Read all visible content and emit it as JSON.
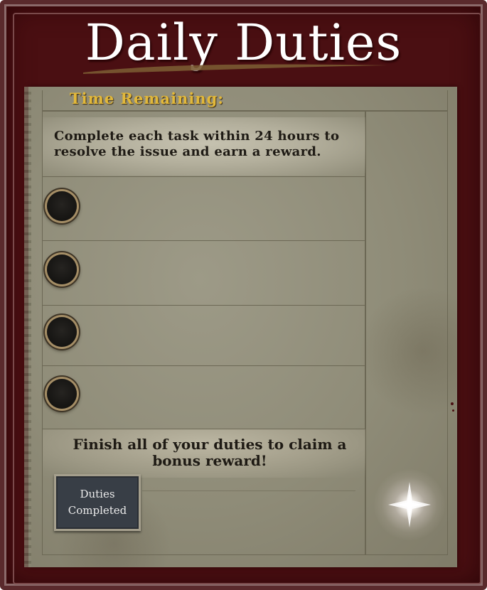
{
  "window": {
    "title": "Daily Duties"
  },
  "header": {
    "time_label": "Time Remaining:"
  },
  "description": {
    "text": "Complete each task within 24 hours to resolve the issue and earn a reward."
  },
  "duties": {
    "slots": [
      {
        "state": "empty"
      },
      {
        "state": "empty"
      },
      {
        "state": "empty"
      },
      {
        "state": "empty"
      }
    ]
  },
  "bonus": {
    "text": "Finish all of your duties to claim a bonus reward!",
    "completed_label_line1": "Duties",
    "completed_label_line2": "Completed"
  },
  "colors": {
    "frame": "#4a0f12",
    "paper": "#8f8c78",
    "time_label": "#e2b83a",
    "title": "#ffffff",
    "status_box": "#383e46"
  },
  "icons": {
    "reward_glow": "sparkle-icon"
  }
}
